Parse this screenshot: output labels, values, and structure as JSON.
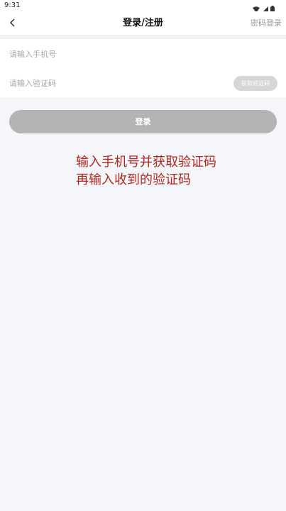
{
  "status_bar": {
    "time": "9:31",
    "icons": [
      "wifi-icon",
      "signal-icon",
      "battery-icon"
    ]
  },
  "header": {
    "back_icon": "chevron-left-icon",
    "title": "登录/注册",
    "password_login_link": "密码登录"
  },
  "form": {
    "phone_placeholder": "请输入手机号",
    "phone_value": "",
    "code_placeholder": "请输入验证码",
    "code_value": "",
    "get_code_label": "获取验证码"
  },
  "login_button_label": "登录",
  "annotation": {
    "line1": "输入手机号并获取验证码",
    "line2": "再输入收到的验证码"
  },
  "colors": {
    "background": "#f4f6f9",
    "annotation_text": "#b3261e",
    "login_button_disabled": "#b4b4b4",
    "code_button_disabled": "#d6d6d6",
    "placeholder_text": "#a6a6a6"
  }
}
